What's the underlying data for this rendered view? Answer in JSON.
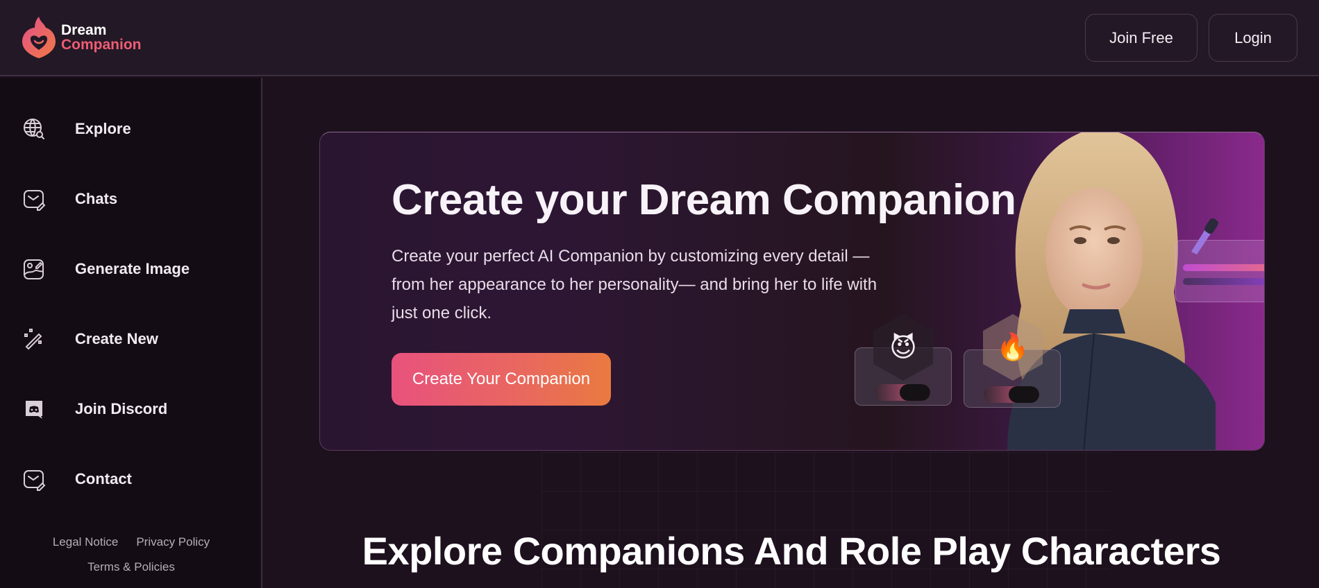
{
  "brand": {
    "line1": "Dream",
    "line2": "Companion"
  },
  "header": {
    "join_label": "Join Free",
    "login_label": "Login"
  },
  "sidebar": {
    "items": [
      {
        "label": "Explore",
        "icon": "globe-search-icon"
      },
      {
        "label": "Chats",
        "icon": "chat-edit-icon"
      },
      {
        "label": "Generate Image",
        "icon": "image-edit-icon"
      },
      {
        "label": "Create New",
        "icon": "magic-wand-icon"
      },
      {
        "label": "Join Discord",
        "icon": "discord-icon"
      },
      {
        "label": "Contact",
        "icon": "mail-edit-icon"
      }
    ],
    "footer": {
      "legal": "Legal Notice",
      "privacy": "Privacy Policy",
      "terms": "Terms & Policies"
    }
  },
  "hero": {
    "title": "Create your Dream Companion",
    "description": "Create your perfect AI Companion by customizing every detail — from her appearance to her personality— and bring her to life with just one click.",
    "cta_label": "Create Your Companion",
    "badges": [
      {
        "emoji": "😈",
        "name": "devil-emoji"
      },
      {
        "emoji": "🔥",
        "name": "fire-emoji"
      }
    ]
  },
  "section": {
    "title": "Explore Companions And Role Play Characters"
  },
  "colors": {
    "accent_pink": "#e8527d",
    "accent_orange": "#e97a40",
    "brand_pink": "#ee5d74"
  }
}
